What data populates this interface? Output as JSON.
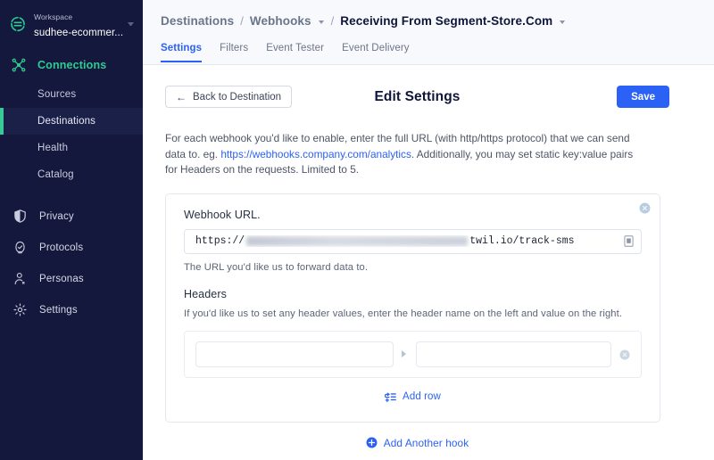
{
  "sidebar": {
    "workspace": {
      "label": "Workspace",
      "name": "sudhee-ecommer...",
      "logo_icon": "segment-logo-icon",
      "caret_icon": "chevron-down-icon"
    },
    "section": {
      "label": "Connections",
      "icon": "connections-nodes-icon",
      "color": "#2fcb92"
    },
    "sub_items": [
      {
        "label": "Sources",
        "active": false
      },
      {
        "label": "Destinations",
        "active": true
      },
      {
        "label": "Health",
        "active": false
      },
      {
        "label": "Catalog",
        "active": false
      }
    ],
    "main_items": [
      {
        "label": "Privacy",
        "icon": "shield-icon"
      },
      {
        "label": "Protocols",
        "icon": "protocols-icon"
      },
      {
        "label": "Personas",
        "icon": "person-icon"
      },
      {
        "label": "Settings",
        "icon": "gear-icon"
      }
    ],
    "active_indicator_color": "#37c996",
    "background_color": "#14183c"
  },
  "header": {
    "breadcrumb": [
      {
        "label": "Destinations",
        "current": false,
        "caret": false
      },
      {
        "label": "Webhooks",
        "current": false,
        "caret": true
      },
      {
        "label": "Receiving From Segment-Store.Com",
        "current": true,
        "caret": true
      }
    ],
    "separator": "/",
    "tabs": [
      {
        "label": "Settings",
        "active": true
      },
      {
        "label": "Filters",
        "active": false
      },
      {
        "label": "Event Tester",
        "active": false
      },
      {
        "label": "Event Delivery",
        "active": false
      }
    ],
    "accent_color": "#2b61f5"
  },
  "content": {
    "back_button": {
      "label": "Back to Destination",
      "icon": "arrow-left-icon"
    },
    "title": "Edit Settings",
    "save_button": {
      "label": "Save",
      "color": "#2b61f5"
    },
    "description": {
      "part1": "For each webhook you'd like to enable, enter the full URL (with http/https protocol) that we can send data to. eg. ",
      "link": "https://webhooks.company.com/analytics",
      "part2": ". Additionally, you may set static key:value pairs for Headers on the requests. Limited to 5."
    },
    "webhook_card": {
      "close_icon": "close-circle-icon",
      "url_label": "Webhook URL.",
      "url_prefix": "https://",
      "url_redacted": true,
      "url_suffix": "twil.io/track-sms",
      "copy_icon": "copy-icon",
      "url_help": "The URL you'd like us to forward data to.",
      "headers_title": "Headers",
      "headers_help": "If you'd like us to set any header values, enter the header name on the left and value on the right.",
      "header_rows": [
        {
          "key_value": "",
          "key_placeholder": "",
          "val_value": "",
          "val_placeholder": "",
          "remove_icon": "close-circle-icon"
        }
      ],
      "add_row": {
        "label": "Add row",
        "icon": "add-row-icon"
      }
    },
    "add_hook": {
      "label": "Add Another hook",
      "icon": "plus-circle-icon"
    }
  }
}
